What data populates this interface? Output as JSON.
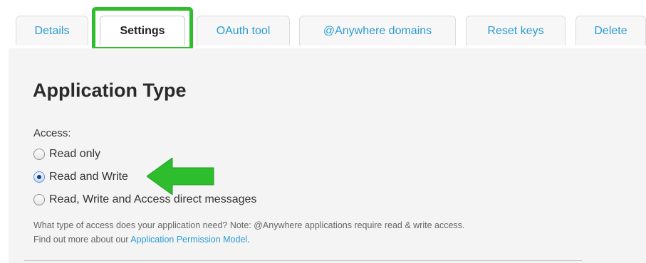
{
  "tabs": [
    {
      "label": "Details",
      "active": false
    },
    {
      "label": "Settings",
      "active": true
    },
    {
      "label": "OAuth tool",
      "active": false
    },
    {
      "label": "@Anywhere domains",
      "active": false
    },
    {
      "label": "Reset keys",
      "active": false
    },
    {
      "label": "Delete",
      "active": false
    }
  ],
  "section": {
    "title": "Application Type",
    "access_label": "Access:",
    "options": [
      {
        "label": "Read only",
        "checked": false
      },
      {
        "label": "Read and Write",
        "checked": true
      },
      {
        "label": "Read, Write and Access direct messages",
        "checked": false
      }
    ],
    "help_text": "What type of access does your application need? Note: @Anywhere applications require read & write access.",
    "help_prefix": "Find out more about our ",
    "help_link": "Application Permission Model",
    "help_suffix": "."
  },
  "annotations": {
    "highlight_color": "#2dbd2d",
    "arrow_color": "#2dbd2d"
  },
  "colors": {
    "link": "#2b9bd3",
    "panel_bg": "#f4f4f4"
  }
}
